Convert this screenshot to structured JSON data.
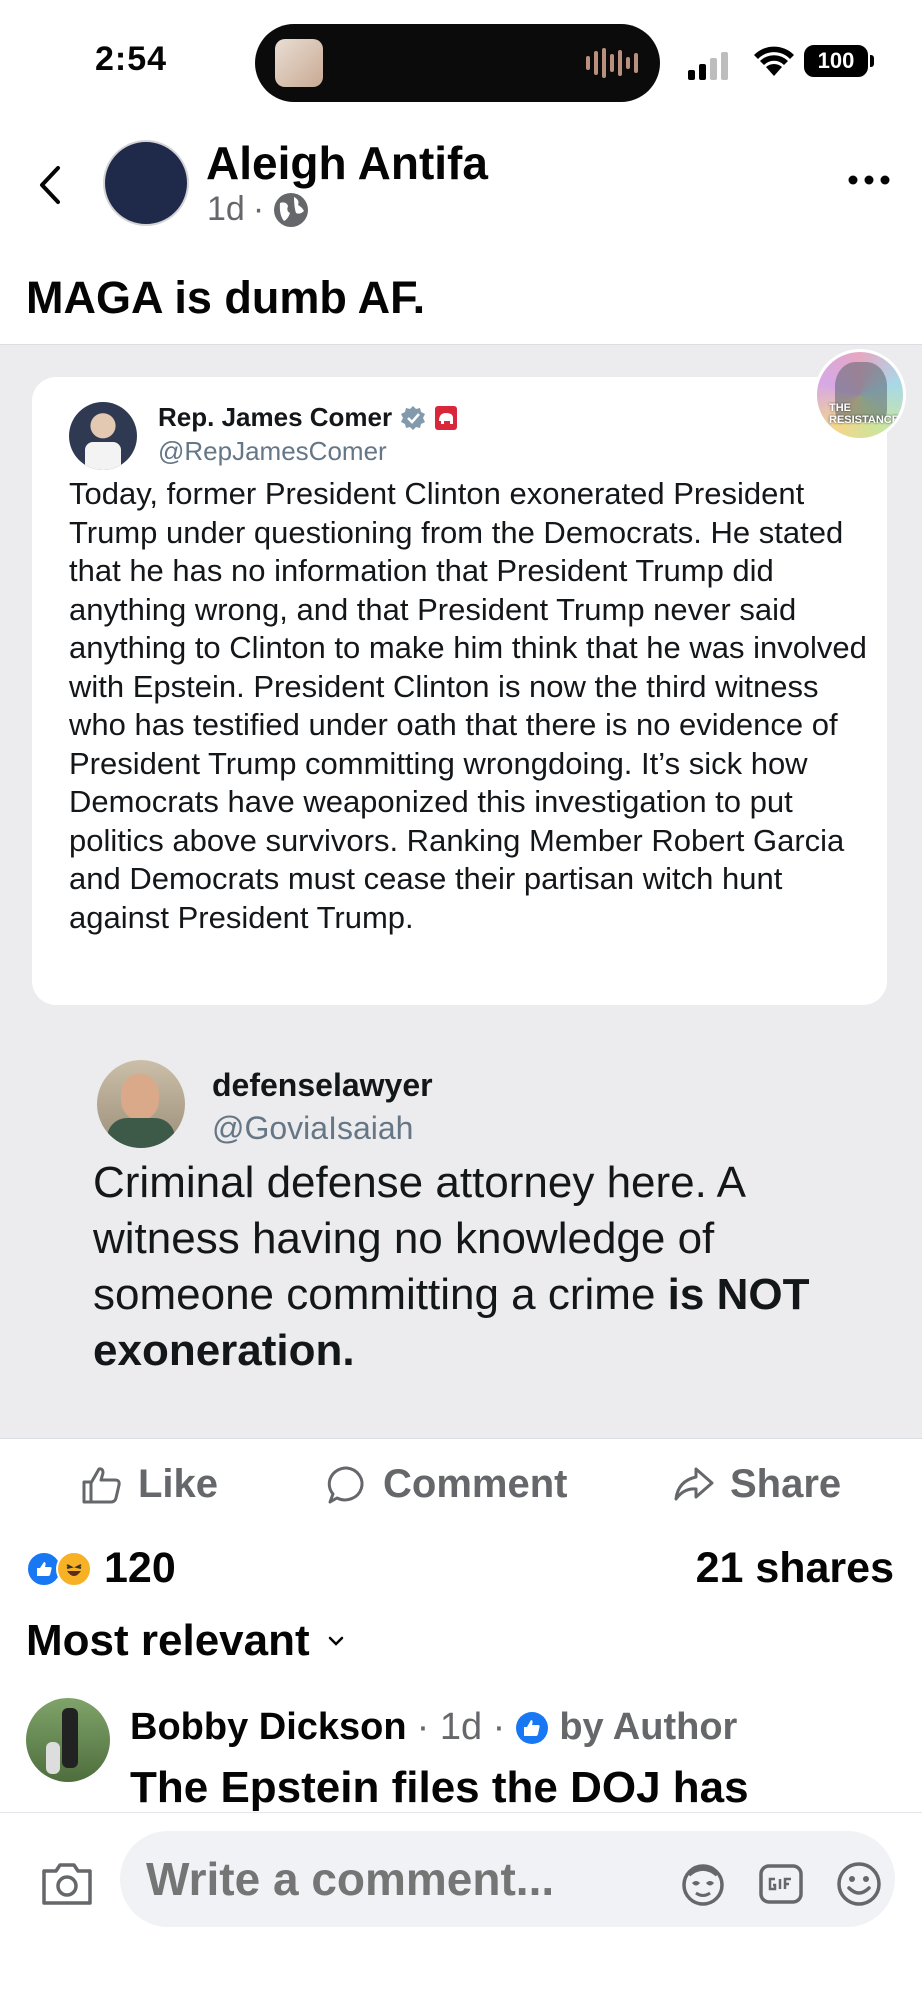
{
  "status_bar": {
    "time": "2:54",
    "battery": "100"
  },
  "post": {
    "author": "Aleigh Antifa",
    "age": "1d",
    "separator": "·",
    "text": "MAGA is dumb AF."
  },
  "shared": {
    "tweet": {
      "name": "Rep. James Comer",
      "handle": "@RepJamesComer",
      "body": "Today, former President Clinton exonerated President Trump under questioning from the Democrats. He stated that he has no information that President Trump did anything wrong, and that President Trump never said anything to Clinton to make him think that he was involved with Epstein. President Clinton is now the third witness who has testified under oath that there is no evidence of President Trump committing wrongdoing. It’s sick how Democrats have weaponized this investigation to put politics above survivors. Ranking Member Robert Garcia and Democrats must cease their partisan witch hunt against President Trump."
    },
    "badge_text_1": "THE",
    "badge_text_2": "RESISTANCE",
    "quote": {
      "name": "defenselawyer",
      "handle": "@GoviaIsaiah",
      "body_plain": "Criminal defense attorney here. A witness having no knowledge of someone committing a crime",
      "body_bold": "is NOT exoneration."
    }
  },
  "actions": {
    "like": "Like",
    "comment": "Comment",
    "share": "Share"
  },
  "engagement": {
    "reaction_count": "120",
    "shares": "21 shares"
  },
  "comments": {
    "sort_label": "Most relevant",
    "items": [
      {
        "author": "Bobby Dickson",
        "meta": "· 1d ·",
        "badge": "by Author",
        "text": "The Epstein files the DOJ has"
      }
    ]
  },
  "composer": {
    "placeholder": "Write a comment..."
  },
  "colors": {
    "facebook_blue": "#1877f2",
    "secondary_text": "#65676b",
    "shared_bg": "#ececef"
  }
}
